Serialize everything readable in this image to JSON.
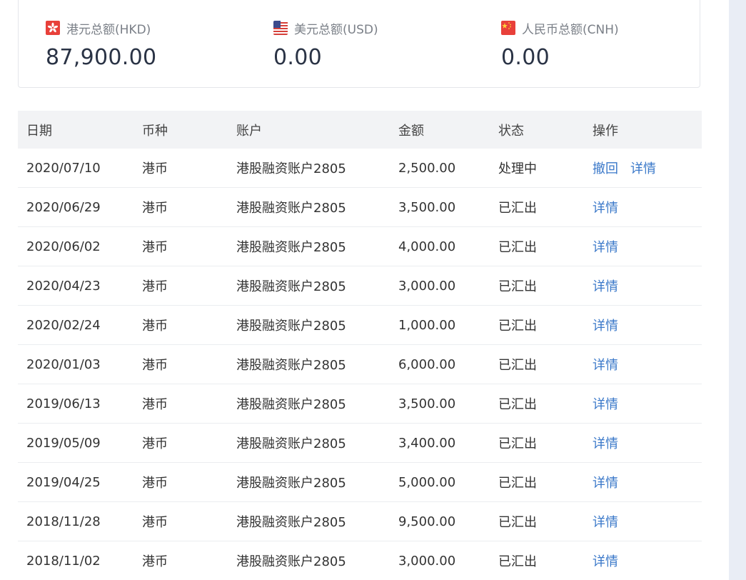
{
  "summary": [
    {
      "flag_icon": "hong-kong-flag-icon",
      "label": "港元总额(HKD)",
      "value": "87,900.00"
    },
    {
      "flag_icon": "us-flag-icon",
      "label": "美元总额(USD)",
      "value": "0.00"
    },
    {
      "flag_icon": "china-flag-icon",
      "label": "人民币总额(CNH)",
      "value": "0.00"
    }
  ],
  "table": {
    "headers": {
      "date": "日期",
      "currency": "币种",
      "account": "账户",
      "amount": "金额",
      "status": "状态",
      "operation": "操作"
    },
    "rows": [
      {
        "date": "2020/07/10",
        "currency": "港币",
        "account": "港股融资账户2805",
        "amount": "2,500.00",
        "status": "处理中",
        "actions": [
          "撤回",
          "详情"
        ]
      },
      {
        "date": "2020/06/29",
        "currency": "港币",
        "account": "港股融资账户2805",
        "amount": "3,500.00",
        "status": "已汇出",
        "actions": [
          "详情"
        ]
      },
      {
        "date": "2020/06/02",
        "currency": "港币",
        "account": "港股融资账户2805",
        "amount": "4,000.00",
        "status": "已汇出",
        "actions": [
          "详情"
        ]
      },
      {
        "date": "2020/04/23",
        "currency": "港币",
        "account": "港股融资账户2805",
        "amount": "3,000.00",
        "status": "已汇出",
        "actions": [
          "详情"
        ]
      },
      {
        "date": "2020/02/24",
        "currency": "港币",
        "account": "港股融资账户2805",
        "amount": "1,000.00",
        "status": "已汇出",
        "actions": [
          "详情"
        ]
      },
      {
        "date": "2020/01/03",
        "currency": "港币",
        "account": "港股融资账户2805",
        "amount": "6,000.00",
        "status": "已汇出",
        "actions": [
          "详情"
        ]
      },
      {
        "date": "2019/06/13",
        "currency": "港币",
        "account": "港股融资账户2805",
        "amount": "3,500.00",
        "status": "已汇出",
        "actions": [
          "详情"
        ]
      },
      {
        "date": "2019/05/09",
        "currency": "港币",
        "account": "港股融资账户2805",
        "amount": "3,400.00",
        "status": "已汇出",
        "actions": [
          "详情"
        ]
      },
      {
        "date": "2019/04/25",
        "currency": "港币",
        "account": "港股融资账户2805",
        "amount": "5,000.00",
        "status": "已汇出",
        "actions": [
          "详情"
        ]
      },
      {
        "date": "2018/11/28",
        "currency": "港币",
        "account": "港股融资账户2805",
        "amount": "9,500.00",
        "status": "已汇出",
        "actions": [
          "详情"
        ]
      },
      {
        "date": "2018/11/02",
        "currency": "港币",
        "account": "港股融资账户2805",
        "amount": "3,000.00",
        "status": "已汇出",
        "actions": [
          "详情"
        ]
      }
    ]
  },
  "colors": {
    "link": "#3a78c9",
    "header_bg": "#f2f3f5",
    "side_strip": "#e9edf5"
  }
}
